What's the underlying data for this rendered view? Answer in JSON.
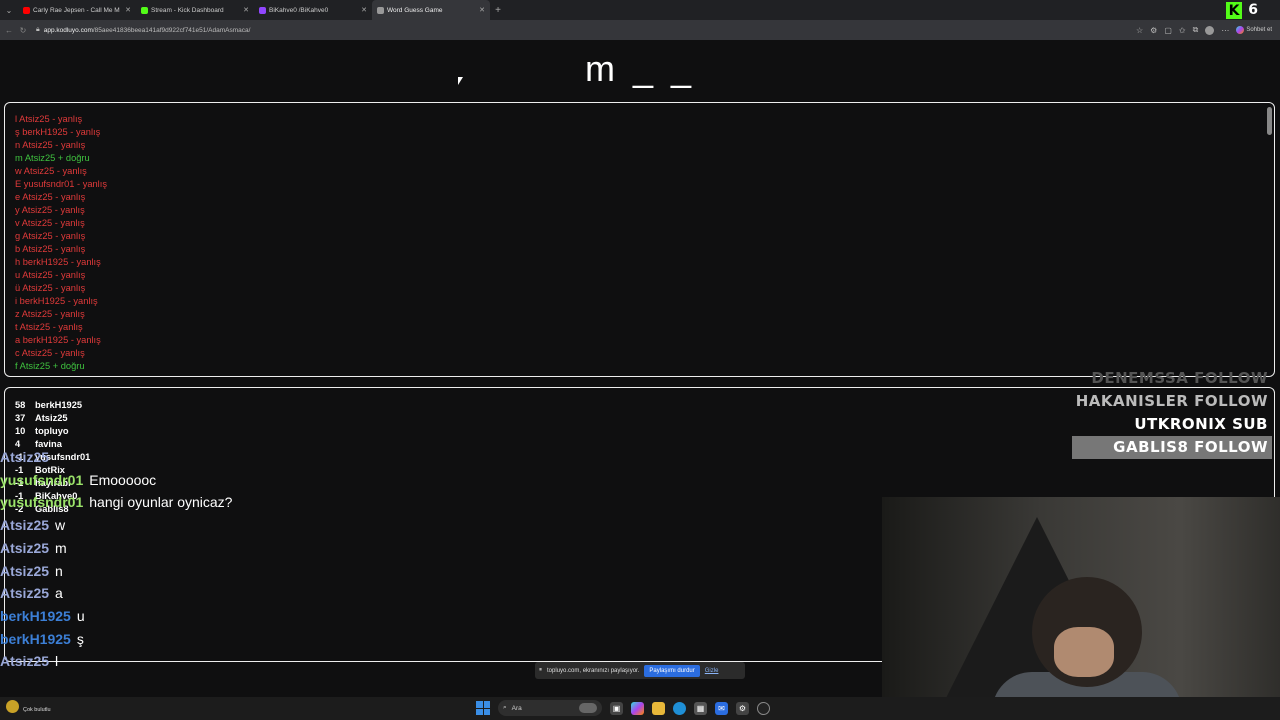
{
  "browser": {
    "tabs": [
      {
        "label": "Carly Rae Jepsen - Call Me M",
        "icon": "youtube-icon",
        "color": "#ff0000"
      },
      {
        "label": "Stream - Kick Dashboard",
        "icon": "kick-icon",
        "color": "#53fc18"
      },
      {
        "label": "BiKahve0 /BiKahve0",
        "icon": "twitch-icon",
        "color": "#9146ff"
      },
      {
        "label": "Word Guess Game",
        "icon": "globe-icon",
        "color": "#999999",
        "active": true
      }
    ],
    "kick_counter": "6",
    "url_host": "app.kodluyo.com",
    "url_path": "/85aee41836beea141af9d922cf741e51/AdamAsmaca/",
    "chat_label": "Sohbet et"
  },
  "game": {
    "word": "m _ _",
    "guesses": [
      {
        "text": "l Atsiz25 - yanlış",
        "status": "wrong"
      },
      {
        "text": "ş berkH1925 - yanlış",
        "status": "wrong"
      },
      {
        "text": "n Atsiz25 - yanlış",
        "status": "wrong"
      },
      {
        "text": "m Atsiz25 + doğru",
        "status": "right"
      },
      {
        "text": "w Atsiz25 - yanlış",
        "status": "wrong"
      },
      {
        "text": "E yusufsndr01 - yanlış",
        "status": "wrong"
      },
      {
        "text": "e Atsiz25 - yanlış",
        "status": "wrong"
      },
      {
        "text": "y Atsiz25 - yanlış",
        "status": "wrong"
      },
      {
        "text": "v Atsiz25 - yanlış",
        "status": "wrong"
      },
      {
        "text": "g Atsiz25 - yanlış",
        "status": "wrong"
      },
      {
        "text": "b Atsiz25 - yanlış",
        "status": "wrong"
      },
      {
        "text": "h berkH1925 - yanlış",
        "status": "wrong"
      },
      {
        "text": "u Atsiz25 - yanlış",
        "status": "wrong"
      },
      {
        "text": "ü Atsiz25 - yanlış",
        "status": "wrong"
      },
      {
        "text": "i berkH1925 - yanlış",
        "status": "wrong"
      },
      {
        "text": "z Atsiz25 - yanlış",
        "status": "wrong"
      },
      {
        "text": "t Atsiz25 - yanlış",
        "status": "wrong"
      },
      {
        "text": "a berkH1925 - yanlış",
        "status": "wrong"
      },
      {
        "text": "c Atsiz25 - yanlış",
        "status": "wrong"
      },
      {
        "text": "f Atsiz25 + doğru",
        "status": "right"
      }
    ],
    "scores": [
      {
        "points": "58",
        "name": "berkH1925"
      },
      {
        "points": "37",
        "name": "Atsiz25"
      },
      {
        "points": "10",
        "name": "topluyo"
      },
      {
        "points": "4",
        "name": "favina"
      },
      {
        "points": "-1",
        "name": "yusufsndr01"
      },
      {
        "points": "-1",
        "name": "BotRix"
      },
      {
        "points": "-1",
        "name": "hayirabi"
      },
      {
        "points": "-1",
        "name": "BiKahve0"
      },
      {
        "points": "-2",
        "name": "Gablis8"
      }
    ]
  },
  "chat": [
    {
      "user": "Atsiz25",
      "msg": "",
      "color": "#9aa8d8"
    },
    {
      "user": "yusufsndr01",
      "msg": "Emoooooc",
      "color": "#9be36a"
    },
    {
      "user": "yusufsndr01",
      "msg": "hangi oyunlar oynicaz?",
      "color": "#9be36a"
    },
    {
      "user": "Atsiz25",
      "msg": "w",
      "color": "#9aa8d8"
    },
    {
      "user": "Atsiz25",
      "msg": "m",
      "color": "#9aa8d8"
    },
    {
      "user": "Atsiz25",
      "msg": "n",
      "color": "#9aa8d8"
    },
    {
      "user": "Atsiz25",
      "msg": "a",
      "color": "#9aa8d8"
    },
    {
      "user": "berkH1925",
      "msg": "u",
      "color": "#3c7fd6"
    },
    {
      "user": "berkH1925",
      "msg": "ş",
      "color": "#3c7fd6"
    },
    {
      "user": "Atsiz25",
      "msg": "l",
      "color": "#9aa8d8"
    }
  ],
  "events": [
    {
      "text": "DENEMSSA  FOLLOW",
      "style": "dim"
    },
    {
      "text": "HAKANISLER  FOLLOW",
      "style": "mid"
    },
    {
      "text": "UTKRONIX  SUB",
      "style": "bright"
    },
    {
      "text": "GABLIS8  FOLLOW",
      "style": "hl"
    }
  ],
  "share": {
    "message": "topluyo.com, ekranınızı paylaşıyor.",
    "stop_label": "Paylaşımı durdur",
    "hide_label": "Gizle"
  },
  "taskbar": {
    "weather_label": "Çok bulutlu",
    "search_placeholder": "Ara"
  }
}
